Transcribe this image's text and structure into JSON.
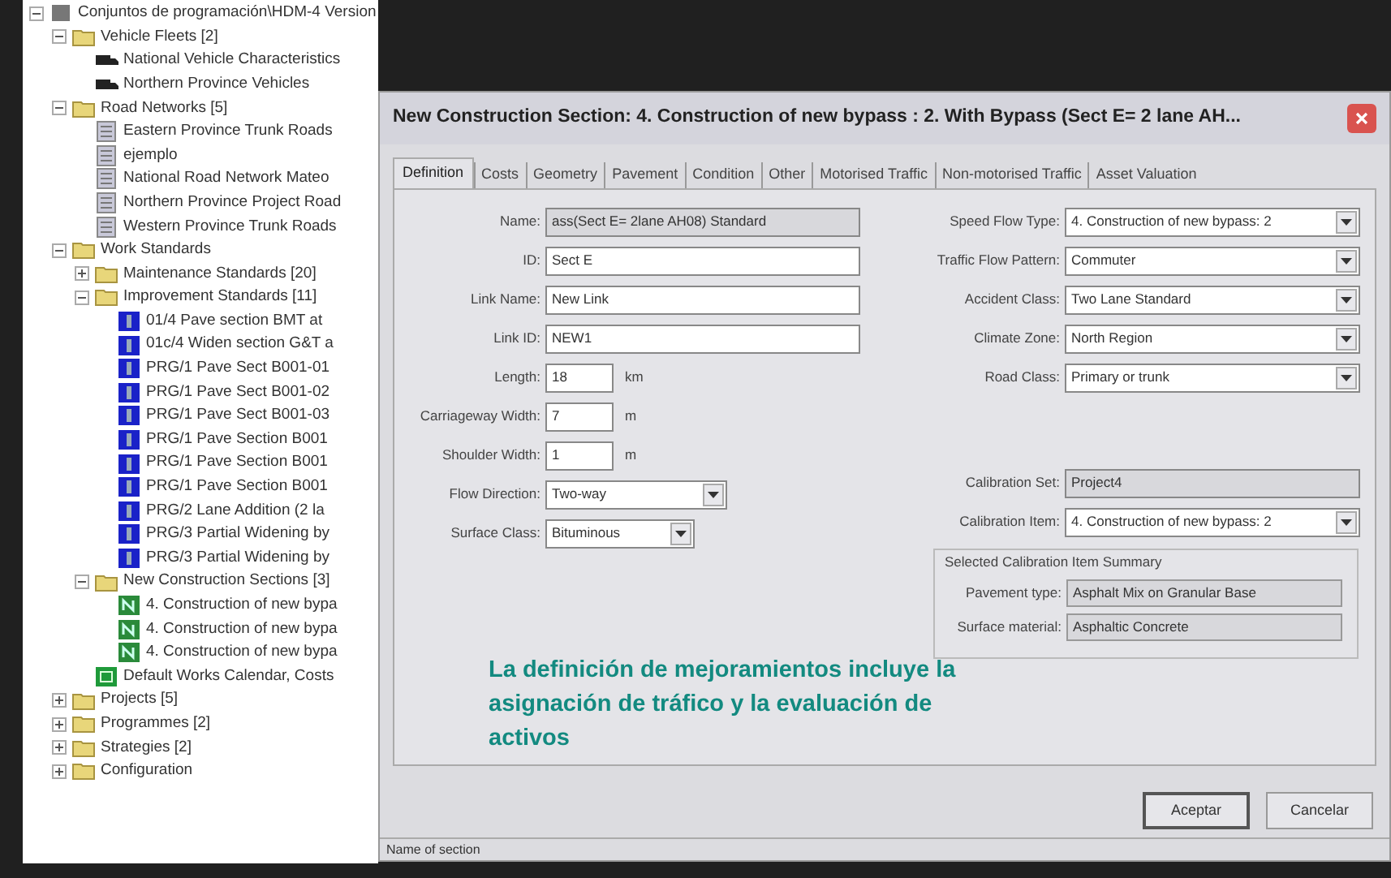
{
  "tree": [
    {
      "label": "Conjuntos de programación\\HDM-4 Version",
      "kind": "root",
      "expanded": true,
      "children": [
        {
          "label": "Vehicle Fleets [2]",
          "kind": "folder",
          "expanded": true,
          "children": [
            {
              "label": "National Vehicle Characteristics",
              "kind": "vehicle"
            },
            {
              "label": "Northern Province Vehicles",
              "kind": "vehicle"
            }
          ]
        },
        {
          "label": "Road Networks [5]",
          "kind": "folder",
          "expanded": true,
          "children": [
            {
              "label": "Eastern Province Trunk Roads",
              "kind": "network"
            },
            {
              "label": "ejemplo",
              "kind": "network"
            },
            {
              "label": "National Road Network Mateo",
              "kind": "network"
            },
            {
              "label": "Northern Province Project Road",
              "kind": "network"
            },
            {
              "label": "Western Province Trunk Roads",
              "kind": "network"
            }
          ]
        },
        {
          "label": "Work Standards",
          "kind": "folder",
          "expanded": true,
          "children": [
            {
              "label": "Maintenance Standards [20]",
              "kind": "folder",
              "expanded": false
            },
            {
              "label": "Improvement Standards [11]",
              "kind": "folder",
              "expanded": true,
              "children": [
                {
                  "label": "01/4 Pave section BMT at",
                  "kind": "improvement"
                },
                {
                  "label": "01c/4 Widen section G&T a",
                  "kind": "improvement"
                },
                {
                  "label": "PRG/1 Pave Sect B001-01",
                  "kind": "improvement"
                },
                {
                  "label": "PRG/1 Pave Sect B001-02",
                  "kind": "improvement"
                },
                {
                  "label": "PRG/1 Pave Sect B001-03",
                  "kind": "improvement"
                },
                {
                  "label": "PRG/1 Pave Section B001",
                  "kind": "improvement"
                },
                {
                  "label": "PRG/1 Pave Section B001",
                  "kind": "improvement"
                },
                {
                  "label": "PRG/1 Pave Section B001",
                  "kind": "improvement"
                },
                {
                  "label": "PRG/2 Lane Addition (2 la",
                  "kind": "improvement"
                },
                {
                  "label": "PRG/3 Partial Widening by",
                  "kind": "improvement"
                },
                {
                  "label": "PRG/3 Partial Widening by",
                  "kind": "improvement"
                }
              ]
            },
            {
              "label": "New Construction Sections [3]",
              "kind": "folder",
              "expanded": true,
              "children": [
                {
                  "label": "4. Construction of new bypa",
                  "kind": "new"
                },
                {
                  "label": "4. Construction of new bypa",
                  "kind": "new"
                },
                {
                  "label": "4. Construction of new bypa",
                  "kind": "new"
                }
              ]
            },
            {
              "label": "Default Works Calendar, Costs",
              "kind": "calendar"
            }
          ]
        },
        {
          "label": "Projects [5]",
          "kind": "folder",
          "expanded": false
        },
        {
          "label": "Programmes [2]",
          "kind": "folder",
          "expanded": false
        },
        {
          "label": "Strategies [2]",
          "kind": "folder",
          "expanded": false
        },
        {
          "label": "Configuration",
          "kind": "folder",
          "expanded": false
        }
      ]
    }
  ],
  "dialog": {
    "title": "New Construction Section: 4. Construction of new bypass : 2. With Bypass (Sect E= 2 lane AH...",
    "tabs": [
      {
        "label": "Definition",
        "selected": true
      },
      {
        "label": "Costs",
        "selected": false
      },
      {
        "label": "Geometry",
        "selected": false
      },
      {
        "label": "Pavement",
        "selected": false
      },
      {
        "label": "Condition",
        "selected": false
      },
      {
        "label": "Other",
        "selected": false
      },
      {
        "label": "Motorised Traffic",
        "selected": false
      },
      {
        "label": "Non-motorised Traffic",
        "selected": false
      },
      {
        "label": "Asset Valuation",
        "selected": false
      }
    ],
    "left_fields": [
      {
        "label": "Name:",
        "kind": "text",
        "value": "ass(Sect E= 2lane AH08) Standard",
        "disabled": true
      },
      {
        "label": "ID:",
        "kind": "text",
        "value": "Sect E",
        "disabled": false
      },
      {
        "label": "Link Name:",
        "kind": "text",
        "value": "New Link",
        "disabled": false
      },
      {
        "label": "Link ID:",
        "kind": "text",
        "value": "NEW1",
        "disabled": false
      },
      {
        "label": "Length:",
        "kind": "number",
        "value": "18",
        "unit": "km",
        "disabled": false
      },
      {
        "label": "Carriageway Width:",
        "kind": "number",
        "value": "7",
        "unit": "m",
        "disabled": false
      },
      {
        "label": "Shoulder Width:",
        "kind": "number",
        "value": "1",
        "unit": "m",
        "disabled": false
      },
      {
        "label": "Flow Direction:",
        "kind": "select",
        "value": "Two-way",
        "disabled": false
      },
      {
        "label": "Surface Class:",
        "kind": "select",
        "value": "Bituminous",
        "disabled": false
      }
    ],
    "right_fields": [
      {
        "label": "Speed Flow Type:",
        "kind": "select",
        "value": "4. Construction of new bypass: 2",
        "disabled": false
      },
      {
        "label": "Traffic Flow Pattern:",
        "kind": "select",
        "value": "Commuter",
        "disabled": false
      },
      {
        "label": "Accident Class:",
        "kind": "select",
        "value": "Two Lane Standard",
        "disabled": false
      },
      {
        "label": "Climate Zone:",
        "kind": "select",
        "value": "North Region",
        "disabled": false
      },
      {
        "label": "Road Class:",
        "kind": "select",
        "value": "Primary or trunk",
        "disabled": false
      },
      {
        "label": "Calibration Set:",
        "kind": "text",
        "value": "Project4",
        "disabled": true
      },
      {
        "label": "Calibration Item:",
        "kind": "select",
        "value": "4. Construction of new bypass: 2",
        "disabled": false
      }
    ],
    "summary": {
      "title": "Selected Calibration Item Summary",
      "rows": [
        {
          "label": "Pavement type:",
          "value": "Asphalt Mix on Granular Base"
        },
        {
          "label": "Surface material:",
          "value": "Asphaltic Concrete"
        }
      ]
    },
    "note": "La definición de mejoramientos incluye la asignación de tráfico y la evaluación de activos",
    "buttons": [
      {
        "label": "Aceptar",
        "default": true
      },
      {
        "label": "Cancelar",
        "default": false
      }
    ],
    "status_bar": "Name of section"
  }
}
